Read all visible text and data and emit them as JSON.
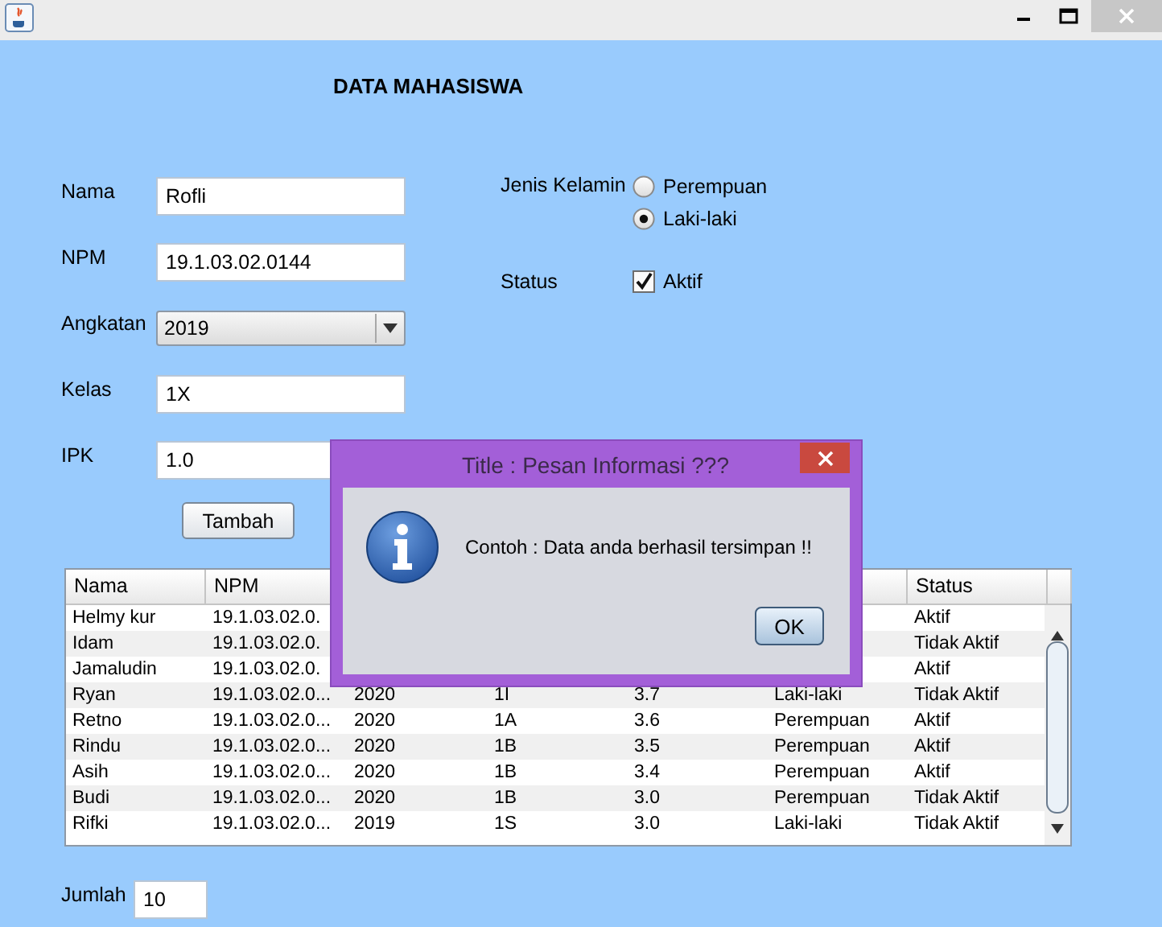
{
  "heading": "DATA MAHASISWA",
  "form": {
    "fields": [
      {
        "label": "Nama",
        "kind": "text",
        "value": "Rofli"
      },
      {
        "label": "NPM",
        "kind": "text",
        "value": "19.1.03.02.0144"
      },
      {
        "label": "Angkatan",
        "kind": "dropdown",
        "value": "2019"
      },
      {
        "label": "Kelas",
        "kind": "text",
        "value": "1X"
      },
      {
        "label": "IPK",
        "kind": "text",
        "value": "1.0"
      }
    ]
  },
  "gender": {
    "label": "Jenis Kelamin",
    "options": [
      {
        "label": "Perempuan",
        "selected": false
      },
      {
        "label": "Laki-laki",
        "selected": true
      }
    ]
  },
  "status": {
    "label": "Status",
    "checkbox": {
      "label": "Aktif",
      "checked": true
    }
  },
  "add_button": "Tambah",
  "table": {
    "columns": [
      "Nama",
      "NPM",
      null,
      null,
      null,
      null,
      "Status"
    ],
    "rows": [
      [
        "Helmy kur",
        "19.1.03.02.0.",
        null,
        null,
        null,
        null,
        "Aktif"
      ],
      [
        "Idam",
        "19.1.03.02.0.",
        null,
        null,
        null,
        null,
        "Tidak Aktif"
      ],
      [
        "Jamaludin",
        "19.1.03.02.0.",
        null,
        null,
        null,
        null,
        "Aktif"
      ],
      [
        "Ryan",
        "19.1.03.02.0...",
        "2020",
        "1I",
        "3.7",
        "Laki-laki",
        "Tidak Aktif"
      ],
      [
        "Retno",
        "19.1.03.02.0...",
        "2020",
        "1A",
        "3.6",
        "Perempuan",
        "Aktif"
      ],
      [
        "Rindu",
        "19.1.03.02.0...",
        "2020",
        "1B",
        "3.5",
        "Perempuan",
        "Aktif"
      ],
      [
        "Asih",
        "19.1.03.02.0...",
        "2020",
        "1B",
        "3.4",
        "Perempuan",
        "Aktif"
      ],
      [
        "Budi",
        "19.1.03.02.0...",
        "2020",
        "1B",
        "3.0",
        "Perempuan",
        "Tidak Aktif"
      ],
      [
        "Rifki",
        "19.1.03.02.0...",
        "2019",
        "1S",
        "3.0",
        "Laki-laki",
        "Tidak Aktif"
      ]
    ]
  },
  "count": {
    "label": "Jumlah",
    "value": "10"
  },
  "dialog": {
    "title": "Title : Pesan Informasi ???",
    "message": "Contoh : Data anda berhasil tersimpan !!",
    "button": "OK"
  }
}
